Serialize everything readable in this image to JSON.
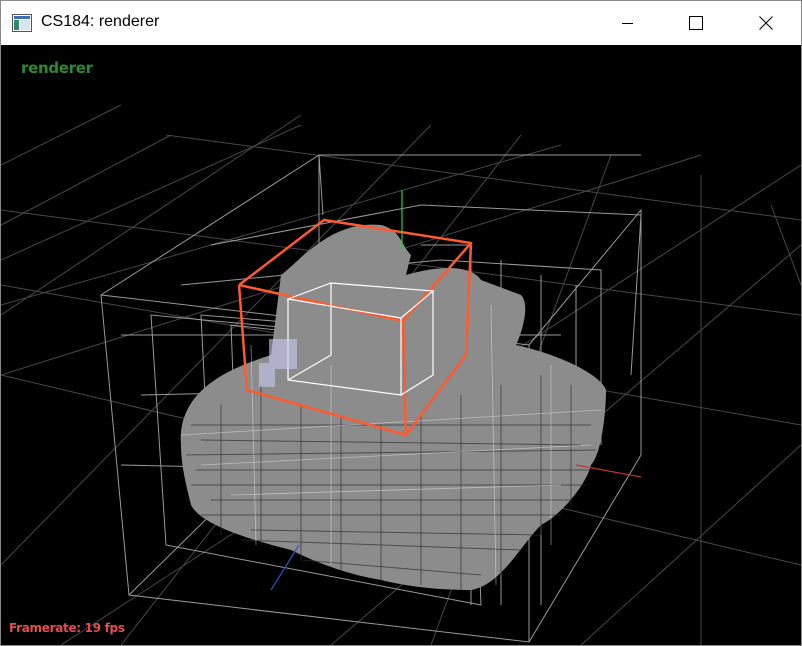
{
  "window": {
    "title": "CS184: renderer",
    "icon": "app-window-icon",
    "controls": {
      "minimize_icon": "minimize-icon",
      "maximize_icon": "maximize-icon",
      "close_icon": "close-icon"
    }
  },
  "viewport": {
    "overlay_title": "renderer",
    "framerate_text": "Framerate: 19 fps",
    "colors": {
      "background": "#000000",
      "overlay_title": "#2f8a2f",
      "framerate": "#e05050",
      "selected_box": "#ff5a2e",
      "mesh": "#8c8c8c",
      "grid": "#5a5a5a",
      "axis_x": "#c0392b",
      "axis_y": "#2ecc40",
      "axis_z": "#3050c0"
    }
  }
}
